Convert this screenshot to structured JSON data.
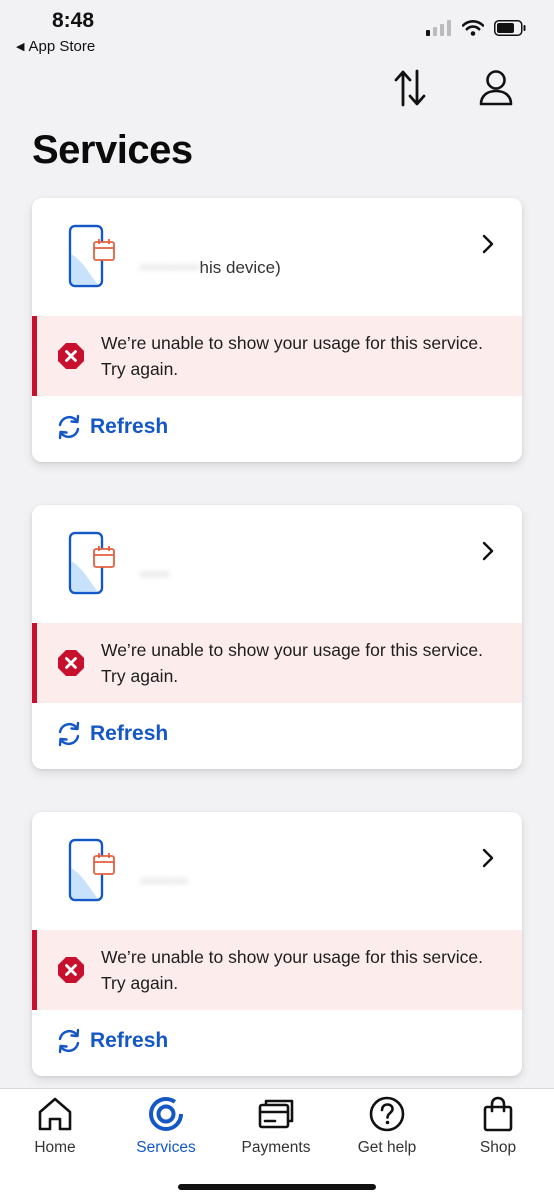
{
  "status_bar": {
    "time": "8:48",
    "back_label": "App Store"
  },
  "header": {
    "title": "Services",
    "icons": [
      "transfer-arrows-icon",
      "account-icon"
    ]
  },
  "services": [
    {
      "name": "",
      "subtitle": "his device)",
      "alert_text": "We’re unable to show your usage for this service. Try again.",
      "refresh_label": "Refresh"
    },
    {
      "name": "",
      "subtitle": "",
      "alert_text": "We’re unable to show your usage for this service. Try again.",
      "refresh_label": "Refresh"
    },
    {
      "name": "",
      "subtitle": "",
      "alert_text": "We’re unable to show your usage for this service. Try again.",
      "refresh_label": "Refresh"
    }
  ],
  "tabs": [
    {
      "label": "Home",
      "icon": "home-icon",
      "active": false
    },
    {
      "label": "Services",
      "icon": "services-icon",
      "active": true
    },
    {
      "label": "Payments",
      "icon": "payments-icon",
      "active": false
    },
    {
      "label": "Get help",
      "icon": "help-icon",
      "active": false
    },
    {
      "label": "Shop",
      "icon": "shop-icon",
      "active": false
    }
  ],
  "colors": {
    "accent": "#1457c7",
    "error": "#c8102e",
    "alert_bg": "#fcecec",
    "background": "#f2f2f4"
  }
}
